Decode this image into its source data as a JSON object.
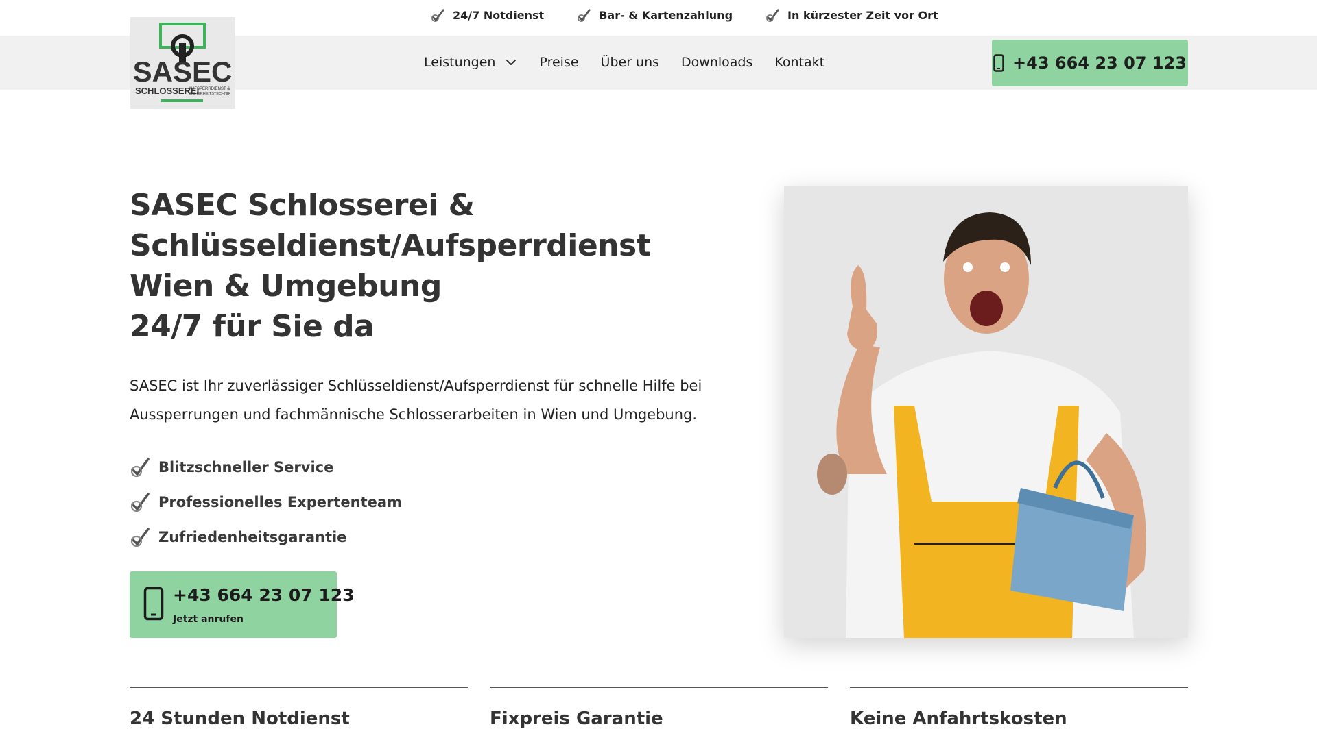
{
  "topbar": {
    "items": [
      {
        "label": "24/7 Notdienst",
        "icon": "check-icon"
      },
      {
        "label": "Bar- & Kartenzahlung",
        "icon": "check-icon"
      },
      {
        "label": "In kürzester Zeit vor Ort",
        "icon": "check-icon"
      }
    ]
  },
  "header": {
    "logo": {
      "brand": "SASEC",
      "line1": "SCHLOSSEREI",
      "line2": "AUFSPERRDIENST &",
      "line3": "SICHERHEITSTECHNIK",
      "accent_color": "#3db35a"
    },
    "nav": [
      {
        "label": "Leistungen",
        "has_dropdown": true
      },
      {
        "label": "Preise"
      },
      {
        "label": "Über uns"
      },
      {
        "label": "Downloads"
      },
      {
        "label": "Kontakt"
      }
    ],
    "phone_button": {
      "label": "+43 664 23 07 123",
      "icon": "phone-icon"
    }
  },
  "hero": {
    "title_lines": [
      "SASEC Schlosserei &",
      "Schlüsseldienst/Aufsperrdienst",
      "Wien & Umgebung",
      "24/7 für Sie da"
    ],
    "description": "SASEC ist Ihr zuverlässiger Schlüsseldienst/Aufsperrdienst für schnelle Hilfe bei Aussperrungen und fachmännische Schlosserarbeiten in Wien und Umgebung.",
    "features": [
      "Blitzschneller Service",
      "Professionelles Expertenteam",
      "Zufriedenheitsgarantie"
    ],
    "cta": {
      "number": "+43 664 23 07 123",
      "sub": "Jetzt anrufen",
      "icon": "phone-icon"
    },
    "image": {
      "subject": "worker-with-toolbox-photo"
    }
  },
  "usps": [
    {
      "title": "24 Stunden Notdienst"
    },
    {
      "title": "Fixpreis Garantie"
    },
    {
      "title": "Keine Anfahrtskosten"
    }
  ],
  "colors": {
    "accent_green": "#8fd4a0",
    "logo_green": "#3db35a",
    "nav_bg": "#f1f1f1",
    "text_dark": "#333333"
  }
}
